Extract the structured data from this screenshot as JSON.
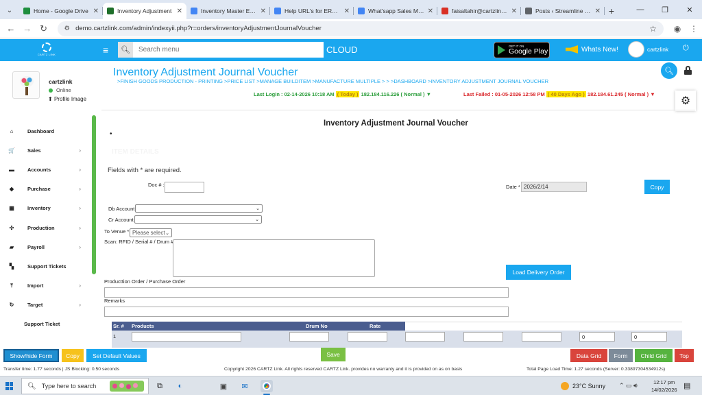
{
  "browser": {
    "tabs": [
      {
        "label": "Home - Google Drive",
        "fav": "#1e8e3e",
        "active": false
      },
      {
        "label": "Inventory Adjustment",
        "fav": "#1e6f2a",
        "active": true
      },
      {
        "label": "Inventory Master Entry",
        "fav": "#4285f4",
        "active": false
      },
      {
        "label": "Help URL's for ERP Sys",
        "fav": "#4285f4",
        "active": false
      },
      {
        "label": "What'sapp Sales Mess",
        "fav": "#4285f4",
        "active": false
      },
      {
        "label": "faisaltahir@cartzlink.co",
        "fav": "#d93025",
        "active": false
      },
      {
        "label": "Posts ‹ Streamline Syst",
        "fav": "#5f6368",
        "active": false
      }
    ],
    "url": "demo.cartzlink.com/admin/indexyii.php?r=orders/inventoryAdjustmentJournalVoucher"
  },
  "header": {
    "logo_text": "CARTZ LINK",
    "search_placeholder": "Search menu",
    "cloud": "CLOUD",
    "gplay_small": "GET IT ON",
    "gplay_big": "Google Play",
    "whats_new": "Whats New!",
    "user": "cartzlink"
  },
  "profile": {
    "name": "cartzlink",
    "status": "Online",
    "image_link": "Profile Image"
  },
  "sidebar": {
    "items": [
      {
        "label": "Dashboard",
        "icon": "home-icon",
        "glyph": "⌂",
        "chev": false
      },
      {
        "label": "Sales",
        "icon": "cart-icon",
        "glyph": "🛒",
        "chev": true
      },
      {
        "label": "Accounts",
        "icon": "bank-icon",
        "glyph": "▬",
        "chev": true
      },
      {
        "label": "Purchase",
        "icon": "tag-icon",
        "glyph": "◆",
        "chev": true
      },
      {
        "label": "Inventory",
        "icon": "grid-icon",
        "glyph": "▦",
        "chev": true
      },
      {
        "label": "Production",
        "icon": "gears-icon",
        "glyph": "✣",
        "chev": true
      },
      {
        "label": "Payroll",
        "icon": "money-icon",
        "glyph": "▰",
        "chev": true
      },
      {
        "label": "Support Tickets",
        "icon": "tickets-icon",
        "glyph": "▚",
        "chev": false
      },
      {
        "label": "Import",
        "icon": "upload-icon",
        "glyph": "⤒",
        "chev": true
      },
      {
        "label": "Target",
        "icon": "refresh-icon",
        "glyph": "↻",
        "chev": true
      },
      {
        "label": "Support Ticket",
        "icon": "",
        "glyph": "",
        "chev": false
      }
    ]
  },
  "page": {
    "title": "Inventory Adjustment Journal Voucher",
    "breadcrumb": ">FINISH GOODS PRODUCTION - PRINTING  >PRICE LIST  >MANAGE BUILDITEM  >MANUFACTURE MULTIPLE  >  >  >DASHBOARD  >INVENTORY ADJUSTMENT JOURNAL VOUCHER",
    "last_login_prefix": "Last Login : 02-14-2026 10:18 AM",
    "last_login_hl": "( Today )",
    "last_login_suffix": "182.184.116.226 ( Normal ) ▼",
    "last_failed_prefix": "Last Failed : 01-05-2026 12:58 PM",
    "last_failed_hl": "( 40 Days Ago )",
    "last_failed_suffix": "182.184.61.245 ( Normal ) ▼"
  },
  "form": {
    "title": "Inventory Adjustment Journal Voucher",
    "bullet": "•",
    "ghost": "ITEM DETAILS",
    "required_note": "Fields with * are required.",
    "doc_label": "Doc # :",
    "doc_value": "",
    "date_label": "Date *",
    "date_value": "2026/2/14",
    "copy": "Copy",
    "db_account_label": "Db Account",
    "cr_account_label": "Cr Account",
    "to_venue_label": "To Venue *",
    "to_venue_value": "Please select",
    "scan_label": "Scan: RFID / Serial # / Drum #",
    "load_delivery": "Load Delivery Order",
    "production_label": "Producttion Order / Purchase Order",
    "remarks_label": "Remarks"
  },
  "grid": {
    "headers": [
      "Sr. #",
      "Products",
      "Drum No",
      "Rate"
    ],
    "row": {
      "sr": "1",
      "qty": "0",
      "amount": "0"
    }
  },
  "toolbar": {
    "show_hide": "Show/hide Form",
    "copy": "Copy",
    "set_default": "Set Default Values",
    "save": "Save",
    "data_grid": "Data Grid",
    "form": "Form",
    "child_grid": "Child Grid",
    "top": "Top"
  },
  "status": {
    "transfer": "Transfer time: 1.77 seconds  |  JS Blocking: 0.50 seconds",
    "copyright": "Copyright 2026 CARTZ Link. All rights reserved CARTZ Link. provides no warranty and it is provided on as on basis",
    "load": "Total Page Load Time: 1.27 seconds (Server: 0.33897304534912s)"
  },
  "taskbar": {
    "search": "Type here to search",
    "weather": "23°C  Sunny",
    "time": "12:17 pm",
    "date": "14/02/2026"
  }
}
